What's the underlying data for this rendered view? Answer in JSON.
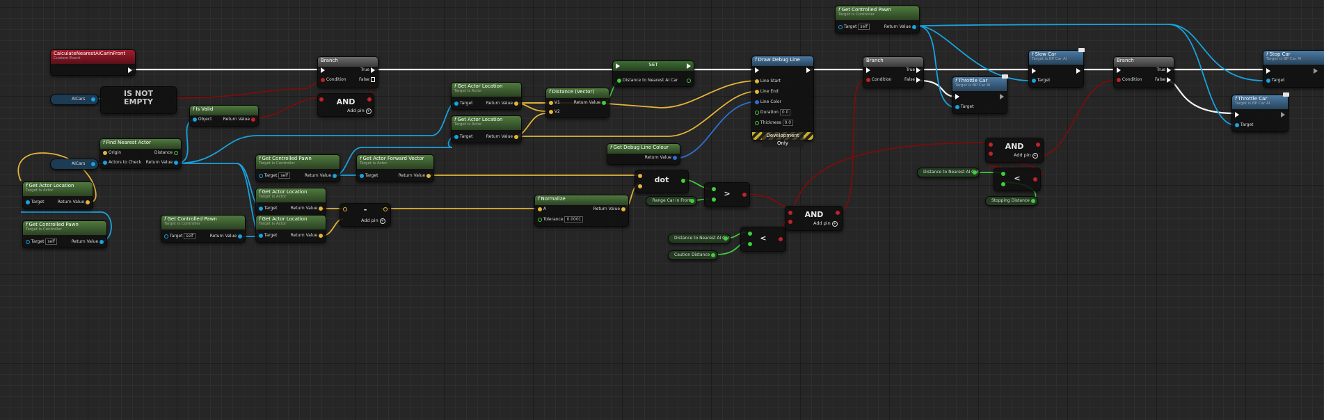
{
  "nodes": {
    "event": {
      "title": "CalculateNearestAICarInFront",
      "subtitle": "Custom Event"
    },
    "aicars_var1": {
      "label": "AICars"
    },
    "aicars_var2": {
      "label": "AICars"
    },
    "is_not_empty": {
      "line1": "IS NOT",
      "line2": "EMPTY"
    },
    "branch1": {
      "title": "Branch",
      "condition": "Condition",
      "true": "True",
      "false": "False"
    },
    "and1": {
      "label": "AND",
      "addpin": "Add pin"
    },
    "is_valid": {
      "title": "Is Valid",
      "object": "Object",
      "return": "Return Value"
    },
    "find_nearest": {
      "title": "Find Nearest Actor",
      "origin": "Origin",
      "actors": "Actors to Check",
      "distance": "Distance",
      "return": "Return Value"
    },
    "get_loc_left": {
      "title": "Get Actor Location",
      "subtitle": "Target is Actor",
      "target": "Target",
      "return": "Return Value"
    },
    "get_pawn_left": {
      "title": "Get Controlled Pawn",
      "subtitle": "Target is Controller",
      "target": "Target",
      "self": "self",
      "return": "Return Value"
    },
    "get_pawn_mid": {
      "title": "Get Controlled Pawn",
      "subtitle": "Target is Controller",
      "target": "Target",
      "self": "self",
      "return": "Return Value"
    },
    "get_pawn_2": {
      "title": "Get Controlled Pawn",
      "subtitle": "Target is Controller",
      "target": "Target",
      "self": "self",
      "return": "Return Value"
    },
    "get_loc_a": {
      "title": "Get Actor Location",
      "subtitle": "Target is Actor",
      "target": "Target",
      "return": "Return Value"
    },
    "get_loc_b": {
      "title": "Get Actor Location",
      "subtitle": "Target is Actor",
      "target": "Target",
      "return": "Return Value"
    },
    "get_loc_c": {
      "title": "Get Actor Location",
      "subtitle": "Target is Actor",
      "target": "Target",
      "return": "Return Value"
    },
    "get_loc_d": {
      "title": "Get Actor Location",
      "subtitle": "Target is Actor",
      "target": "Target",
      "return": "Return Value"
    },
    "minus": {
      "label": "-",
      "addpin": "Add pin"
    },
    "fwd_vec": {
      "title": "Get Actor Forward Vector",
      "subtitle": "Target is Actor",
      "target": "Target",
      "return": "Return Value"
    },
    "distance": {
      "title": "Distance (Vector)",
      "v1": "V1",
      "v2": "V2",
      "return": "Return Value"
    },
    "set": {
      "title": "SET",
      "pin": "Distance to Nearest AI Car"
    },
    "draw_debug": {
      "title": "Draw Debug Line",
      "linestart": "Line Start",
      "lineend": "Line End",
      "linecolor": "Line Color",
      "duration": "Duration",
      "duration_val": "0.0",
      "thickness": "Thickness",
      "thickness_val": "0.0",
      "devonly": "Development Only"
    },
    "debug_colour": {
      "title": "Get Debug Line Colour",
      "return": "Return Value"
    },
    "normalize": {
      "title": "Normalize",
      "a": "A",
      "tolerance": "Tolerance",
      "tolerance_val": "0.0001",
      "return": "Return Value"
    },
    "dot": {
      "label": "dot"
    },
    "range_var": {
      "label": "Range Car in Front"
    },
    "greater": {
      "label": ">"
    },
    "dist_var": {
      "label": "Distance to Nearest AI Car"
    },
    "caution_var": {
      "label": "Caution Distance"
    },
    "less1": {
      "label": "<"
    },
    "and2": {
      "label": "AND",
      "addpin": "Add pin"
    },
    "get_pawn_top": {
      "title": "Get Controlled Pawn",
      "subtitle": "Target is Controller",
      "target": "Target",
      "self": "self",
      "return": "Return Value"
    },
    "branch2": {
      "title": "Branch",
      "condition": "Condition",
      "true": "True",
      "false": "False"
    },
    "throttle1": {
      "title": "Throttle Car",
      "subtitle": "Target is BP Car AI",
      "target": "Target"
    },
    "slow_car": {
      "title": "Slow Car",
      "subtitle": "Target is BP Car AI",
      "target": "Target"
    },
    "and3": {
      "label": "AND",
      "addpin": "Add pin"
    },
    "dist_var2": {
      "label": "Distance to Nearest AI Car"
    },
    "stopping_var": {
      "label": "Stopping Distance"
    },
    "less2": {
      "label": "<"
    },
    "branch3": {
      "title": "Branch",
      "condition": "Condition",
      "true": "True",
      "false": "False"
    },
    "stop_car": {
      "title": "Stop Car",
      "subtitle": "Target is BP Car AI",
      "target": "Target"
    },
    "throttle2": {
      "title": "Throttle Car",
      "subtitle": "Target is BP Car AI",
      "target": "Target"
    }
  },
  "colors": {
    "exec": "#f2f2f2",
    "object": "#17a3e0",
    "vector": "#e5b53a",
    "float": "#3fcf3a",
    "bool": "#7a0d0d",
    "color": "#2f6fd1",
    "header_green": "#4f7a3e",
    "header_blue": "#4c7aa3",
    "header_red": "#a51c2a"
  }
}
